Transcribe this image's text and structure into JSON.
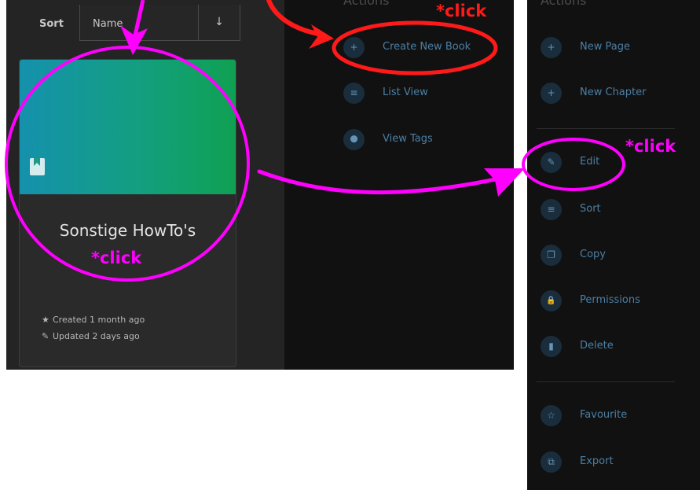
{
  "shelf": {
    "sort_label": "Sort",
    "sort_value": "Name",
    "sort_direction_icon": "↓",
    "book": {
      "title": "Sonstige HowTo's",
      "cover_icon": "book-icon",
      "created": "Created 1 month ago",
      "updated": "Updated 2 days ago"
    }
  },
  "shelf_actions": {
    "title": "Actions",
    "items": [
      {
        "label": "Create New Book",
        "icon": "plus-icon",
        "glyph": "+"
      },
      {
        "label": "List View",
        "icon": "list-icon",
        "glyph": "≡"
      },
      {
        "label": "View Tags",
        "icon": "tag-icon",
        "glyph": "⬤"
      }
    ]
  },
  "book_actions": {
    "title": "Actions",
    "items": [
      {
        "label": "New Page",
        "icon": "plus-icon",
        "glyph": "+"
      },
      {
        "label": "New Chapter",
        "icon": "plus-icon",
        "glyph": "+"
      },
      {
        "label": "Edit",
        "icon": "pencil-icon",
        "glyph": "✎"
      },
      {
        "label": "Sort",
        "icon": "sort-icon",
        "glyph": "≡"
      },
      {
        "label": "Copy",
        "icon": "copy-icon",
        "glyph": "❐"
      },
      {
        "label": "Permissions",
        "icon": "lock-icon",
        "glyph": "🔒"
      },
      {
        "label": "Delete",
        "icon": "trash-icon",
        "glyph": "▮"
      },
      {
        "label": "Favourite",
        "icon": "star-icon",
        "glyph": "☆"
      },
      {
        "label": "Export",
        "icon": "export-icon",
        "glyph": "⧉"
      }
    ]
  },
  "annotations": {
    "click_note": "*click",
    "colors": {
      "magenta": "#ff00ff",
      "red": "#ff1a1a"
    }
  },
  "colors": {
    "link_blue": "#4c7fa4",
    "panel_dark": "#111111",
    "panel_gray": "#242424"
  }
}
